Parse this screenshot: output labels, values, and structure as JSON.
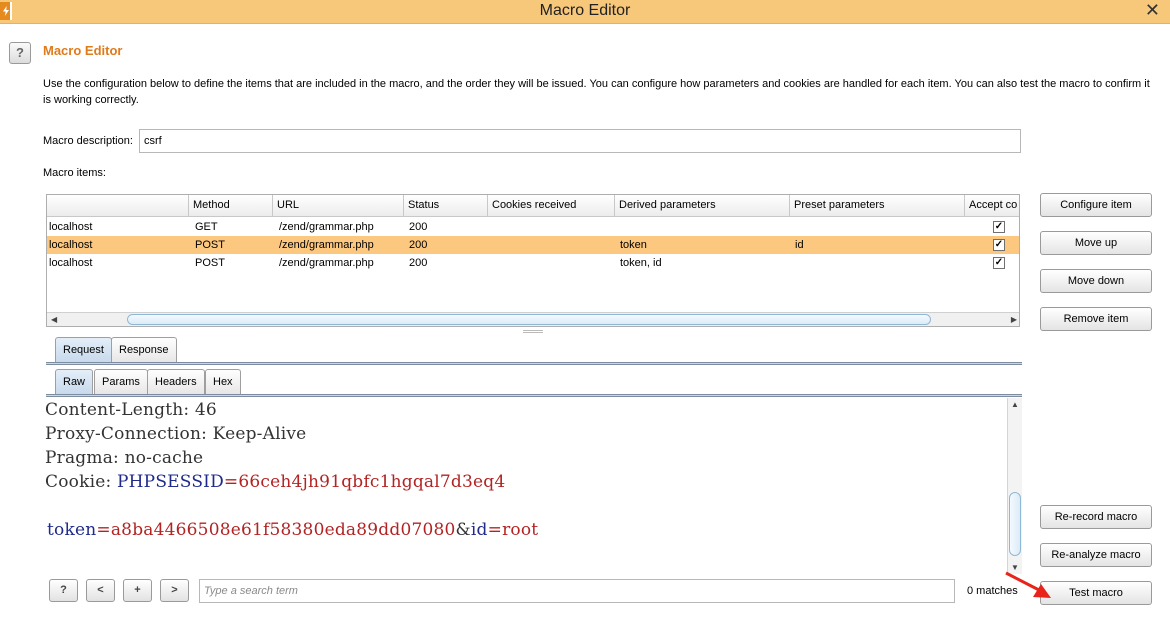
{
  "window": {
    "title": "Macro Editor",
    "close_glyph": "✕"
  },
  "header": {
    "help_glyph": "?",
    "title": "Macro Editor",
    "description": "Use the configuration below to define the items that are included in the macro, and the order they will be issued. You can configure how parameters and cookies are handled for each item. You can also test the macro to confirm it is working correctly."
  },
  "macro_description": {
    "label": "Macro description:",
    "value": "csrf"
  },
  "macro_items": {
    "label": "Macro items:",
    "columns": [
      "",
      "Method",
      "URL",
      "Status",
      "Cookies received",
      "Derived parameters",
      "Preset parameters",
      "Accept co"
    ],
    "rows": [
      {
        "host": "localhost",
        "method": "GET",
        "url": "/zend/grammar.php",
        "status": "200",
        "cookies": "",
        "derived": "",
        "preset": "",
        "accept": "✓"
      },
      {
        "host": "localhost",
        "method": "POST",
        "url": "/zend/grammar.php",
        "status": "200",
        "cookies": "",
        "derived": "token",
        "preset": "id",
        "accept": "✓"
      },
      {
        "host": "localhost",
        "method": "POST",
        "url": "/zend/grammar.php",
        "status": "200",
        "cookies": "",
        "derived": "token, id",
        "preset": "",
        "accept": "✓"
      }
    ],
    "selected_row": 1
  },
  "side_buttons": {
    "configure": "Configure item",
    "move_up": "Move up",
    "move_down": "Move down",
    "remove": "Remove item",
    "rerecord": "Re-record macro",
    "reanalyze": "Re-analyze macro",
    "test": "Test macro"
  },
  "tabs_top": [
    "Request",
    "Response"
  ],
  "tabs_sub": [
    "Raw",
    "Params",
    "Headers",
    "Hex"
  ],
  "editor": {
    "lines": [
      {
        "plain": "Content-Length: 46"
      },
      {
        "plain": "Proxy-Connection: Keep-Alive"
      },
      {
        "plain": "Pragma: no-cache"
      },
      {
        "prefix": "Cookie: ",
        "key": "PHPSESSID",
        "eq": "=",
        "value": "66ceh4jh91qbfc1hgqal7d3eq4"
      },
      {
        "k1": "token",
        "e1": "=",
        "v1": "a8ba4466508e61f58380eda89dd07080",
        "amp": "&",
        "k2": "id",
        "e2": "=",
        "v2": "root"
      }
    ]
  },
  "search_bar": {
    "help": "?",
    "prev": "<",
    "add": "+",
    "next": ">",
    "placeholder": "Type a search term",
    "matches": "0 matches"
  },
  "colors": {
    "accent": "#e07b1b",
    "titlebar": "#f7c77a",
    "selected_row": "#fcc77f",
    "arrow": "#e8231c"
  }
}
